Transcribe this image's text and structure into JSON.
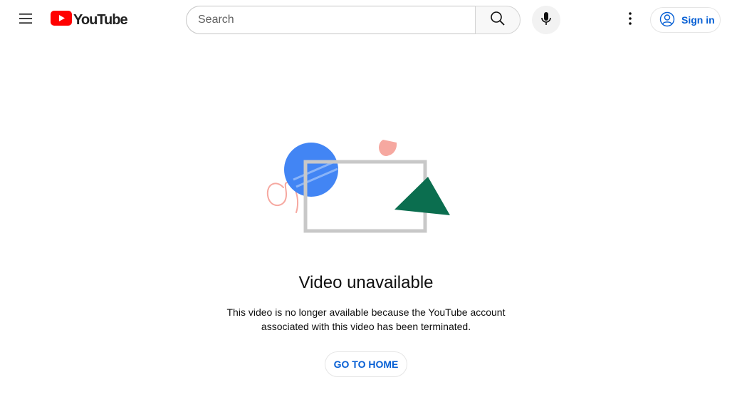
{
  "masthead": {
    "menu_icon": "hamburger-menu-icon",
    "logo_text": "YouTube",
    "logo_color": "#ff0000",
    "search": {
      "placeholder": "Search",
      "value": ""
    },
    "search_icon": "search-icon",
    "voice_icon": "microphone-icon",
    "settings_icon": "more-vertical-icon",
    "signin": {
      "label": "Sign in",
      "icon": "account-circle-icon",
      "color": "#065fd4"
    }
  },
  "error": {
    "title": "Video unavailable",
    "message": "This video is no longer available because the YouTube account associated with this video has been terminated.",
    "home_button": "GO TO HOME"
  },
  "colors": {
    "accent_blue": "#065fd4",
    "illustration_blue": "#4285f4",
    "illustration_green": "#0b6e4f",
    "illustration_pink": "#f6a8a0",
    "illustration_frame": "#c8c8c8"
  }
}
